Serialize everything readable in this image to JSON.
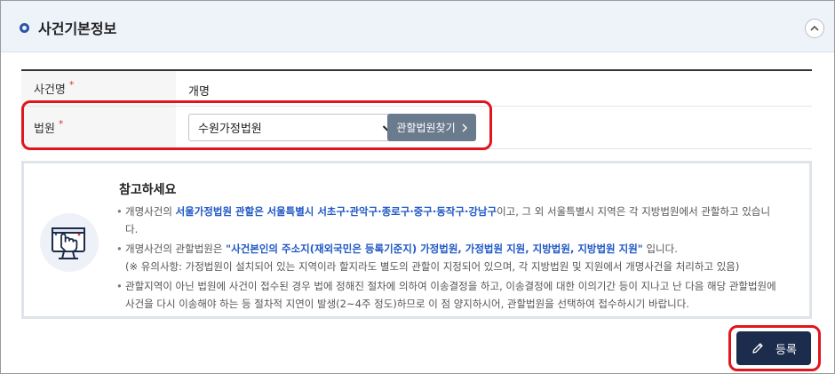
{
  "section": {
    "title": "사건기본정보"
  },
  "form": {
    "case_name_label": "사건명",
    "case_name_required": "*",
    "case_name_value": "개명",
    "court_label": "법원",
    "court_required": "*",
    "court_selected": "수원가정법원",
    "find_court_button": "관할법원찾기"
  },
  "notice": {
    "title": "참고하세요",
    "bullet1": {
      "t1": "개명사건의 ",
      "h1": "서울가정법원 관할은",
      "t2": " ",
      "h2": "서울특별시 서초구·관악구·종로구·중구·동작구·강남구",
      "t3": "이고, 그 외 서울특별시 지역은 각 지방법원에서 관할하고 있습니",
      "t4": "다."
    },
    "bullet2": {
      "t1": "개명사건의 관할법원은 ",
      "h1": "\"사건본인의 주소지(재외국민은 등록기준지) 가정법원, 가정법원 지원, 지방법원, 지방법원 지원\"",
      "t2": " 입니다.",
      "t3": "(※ 유의사항: 가정법원이 설치되어 있는 지역이라 할지라도 별도의 관할이 지정되어 있으며, 각 지방법원 및 지원에서 개명사건을 처리하고 있음)"
    },
    "bullet3": {
      "t1": "관할지역이 아닌 법원에 사건이 접수된 경우 법에 정해진 절차에 의하여 이송결정을 하고, 이송결정에 대한 이의기간 등이 지나고 난 다음 해당 관할법원에",
      "t2": "사건을 다시 이송해야 하는 등 절차적 지연이 발생(2~4주 정도)하므로 이 점 양지하시어, 관할법원을 선택하여 접수하시기 바랍니다."
    }
  },
  "actions": {
    "register_button": "등록"
  },
  "colors": {
    "accent": "#2b56a6",
    "highlight_text": "#1f58c4",
    "button_dark": "#1b2c4c",
    "button_gray": "#6b7b8e",
    "annotation_red": "#e0151d"
  },
  "icons": [
    "ring-icon",
    "chevron-up-icon",
    "chevron-down-icon",
    "chevron-right-icon",
    "touch-screen-icon",
    "pencil-icon"
  ]
}
